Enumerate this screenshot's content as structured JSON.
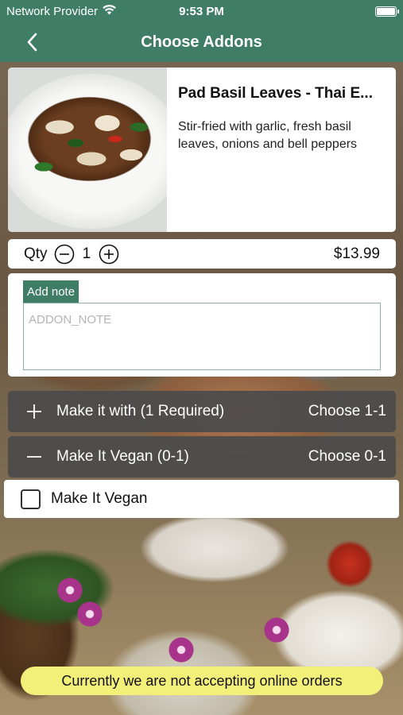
{
  "status_bar": {
    "carrier": "Network Provider",
    "time": "9:53 PM"
  },
  "nav": {
    "title": "Choose Addons"
  },
  "product": {
    "name": "Pad Basil Leaves - Thai E...",
    "description": "Stir-fried with garlic, fresh basil leaves, onions and bell peppers"
  },
  "quantity": {
    "label": "Qty",
    "value": "1",
    "price": "$13.99"
  },
  "note": {
    "tag": "Add note",
    "placeholder": "ADDON_NOTE"
  },
  "groups": [
    {
      "title": "Make it with (1 Required)",
      "range": "Choose 1-1",
      "icon": "plus-icon"
    },
    {
      "title": "Make It Vegan (0-1)",
      "range": "Choose 0-1",
      "icon": "minus-icon"
    }
  ],
  "options": [
    {
      "label": "Make It Vegan",
      "checked": false
    }
  ],
  "banner": {
    "text": "Currently we are not accepting online orders"
  },
  "colors": {
    "header": "#3f7d66",
    "group_bar": "#4b4b4b",
    "banner": "#f3f07a"
  }
}
